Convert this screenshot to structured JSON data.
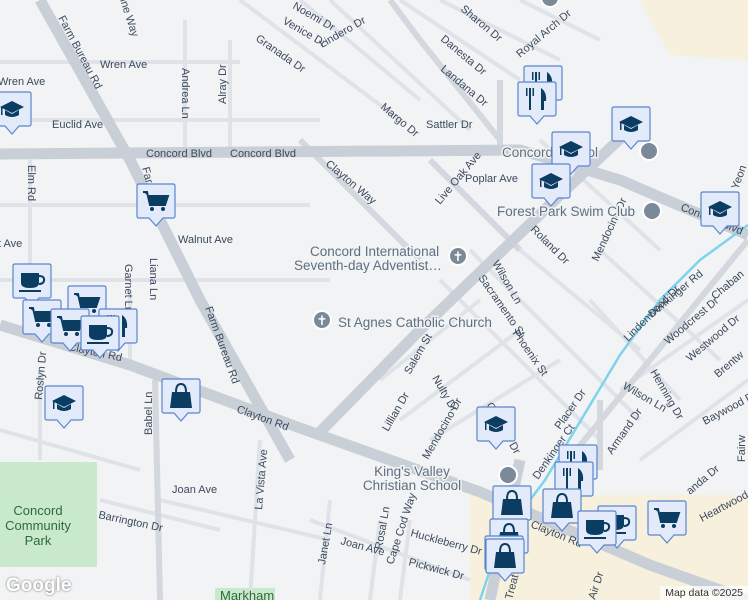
{
  "streets": {
    "farm_bureau_top": "Farm Bureau Rd",
    "wren": "Wren Ave",
    "euclid": "Euclid Ave",
    "concord_blvd_1": "Concord Blvd",
    "concord_blvd_2": "Concord Blvd",
    "concord_blvd_3": "Concord Blvd",
    "andrea": "Andrea Ln",
    "alray": "Alray Dr",
    "elm": "Elm Rd",
    "walnut": "Walnut Ave",
    "walnut_left": "t Ave",
    "farm_bureau_mid": "Farm Bureau Rd",
    "farm_bureau_short": "Far  au Rd",
    "liana": "Liana Ln",
    "garnet": "Garnet Ln",
    "clayton_rd_1": "Clayton Rd",
    "clayton_rd_2": "Clayton Rd",
    "clayton_rd_3": "Clayton Rd",
    "roslyn": "Roslyn Dr",
    "babel": "Babel Ln",
    "la_vista": "La Vista Ave",
    "joan": "Joan Ave",
    "joan_2": "Joan Ave",
    "barrington": "Barrington Dr",
    "janet": "Janet Ln",
    "rosal": "Rosal Ln",
    "cape_cod": "Cape Cod Way",
    "huckleberry": "Huckleberry Dr",
    "pickwick": "Pickwick Dr",
    "treat": "Treat Blvd",
    "air": "Air Dr",
    "noemi": "Noemi Dr",
    "venice": "Venice Dr",
    "granada": "Granada Dr",
    "lindero": "Lindero Dr",
    "margo": "Margo Dr",
    "sattler": "Sattler Dr",
    "sharon": "Sharon Dr",
    "danesta": "Danesta Dr",
    "royal_arch": "Royal Arch Dr",
    "landana": "Landana Dr",
    "clayton_way": "Clayton Way",
    "live_oak": "Live Oak Ave",
    "poplar": "Poplar Ave",
    "roland": "Roland Dr",
    "mendocino_1": "Mendocino Dr",
    "mendocino_2": "Mendocino Dr",
    "wilson_1": "Wilson Ln",
    "wilson_2": "Wilson Ln",
    "sacramento": "Sacramento St",
    "phoenix": "Phoenix St",
    "lindenwood": "Lindenwood Dr",
    "denkinger": "Denkinger Rd",
    "denkinger_ct": "Denkinger Ct",
    "chaban": "Chaban",
    "woodcrest": "Woodcrest Dr",
    "westwood": "Westwood Dr",
    "brentw": "Brentw",
    "henning": "Henning Dr",
    "baywood": "Baywood Dr",
    "fairw": "Fairw",
    "heartwood": "Heartwood Dr",
    "salem": "Salem St",
    "nulty": "Nulty Dr",
    "lillian": "Lillian Dr",
    "placer": "Placer Dr",
    "carreras": "Carreras Dr",
    "armand": "Armand Dr",
    "yeon": "Yeon",
    "corinne": "ine Way",
    "landa": "anda Dr"
  },
  "pois": {
    "adventist": [
      "Concord International",
      "Seventh-day Adventist…"
    ],
    "st_agnes": "St Agnes Catholic Church",
    "concord_school": "Concord    School",
    "swim_club": "Forest Park Swim Club",
    "kings_valley": [
      "King's Valley",
      "Christian School"
    ],
    "park": [
      "Concord",
      "Community",
      "Park"
    ],
    "markham": "Markham"
  },
  "footer": {
    "logo": "Google",
    "attribution": "Map data ©2025"
  },
  "colors": {
    "marker_fill": "#e3ebfb",
    "marker_border": "#5b85cf",
    "icon": "#0b3d62",
    "creek": "#7fd3ec",
    "commercial": "#f6f0dc",
    "park": "#c9e9cc"
  }
}
